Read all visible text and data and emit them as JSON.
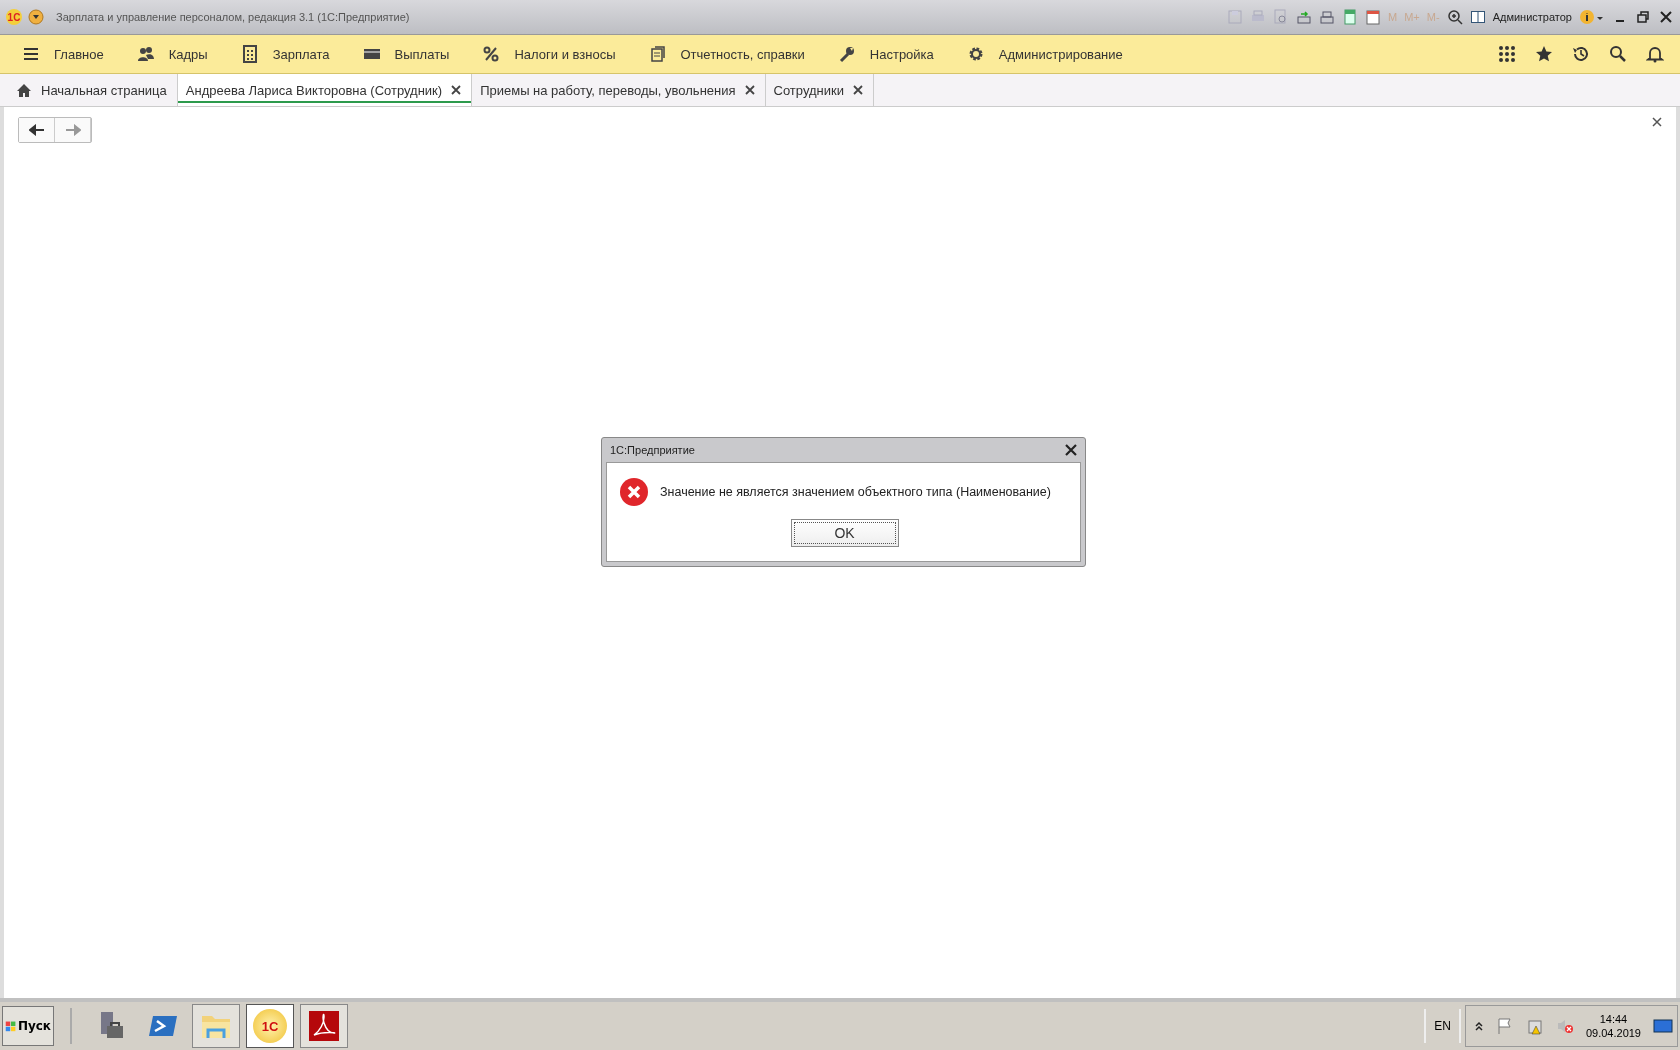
{
  "window": {
    "logo": "1С",
    "title": "Зарплата и управление персоналом, редакция 3.1  (1С:Предприятие)",
    "memory_buttons": [
      "M",
      "M+",
      "M-"
    ],
    "user": "Администратор"
  },
  "menu": [
    {
      "label": "Главное"
    },
    {
      "label": "Кадры"
    },
    {
      "label": "Зарплата"
    },
    {
      "label": "Выплаты"
    },
    {
      "label": "Налоги и взносы"
    },
    {
      "label": "Отчетность, справки"
    },
    {
      "label": "Настройка"
    },
    {
      "label": "Администрирование"
    }
  ],
  "tabs": [
    {
      "label": "Начальная страница",
      "selected": false
    },
    {
      "label": "Андреева Лариса Викторовна (Сотрудник)",
      "selected": true
    },
    {
      "label": "Приемы на работу, переводы, увольнения",
      "selected": false
    },
    {
      "label": "Сотрудники",
      "selected": false
    }
  ],
  "dialog": {
    "title": "1С:Предприятие",
    "message": "Значение не является значением объектного типа (Наименование)",
    "button": "OK"
  },
  "taskbar": {
    "start": "Пуск",
    "logo": "1С",
    "language": "EN",
    "time": "14:44",
    "date": "09.04.2019"
  }
}
